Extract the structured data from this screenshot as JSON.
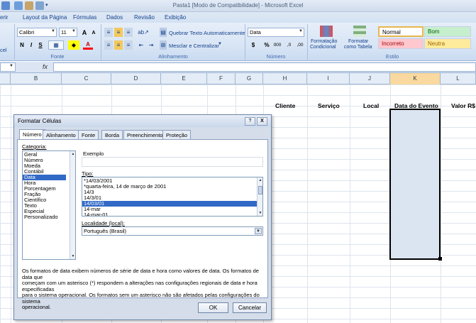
{
  "window": {
    "title": "Pasta1  [Modo de Compatibilidade] - Microsoft Excel"
  },
  "ribbon_tabs": [
    "erir",
    "Layout da Página",
    "Fórmulas",
    "Dados",
    "Revisão",
    "Exibição"
  ],
  "ribbon": {
    "font_name": "Calibri",
    "font_size": "11",
    "bold": "N",
    "italic": "I",
    "underline": "S",
    "grow_font": "A",
    "shrink_font": "A",
    "font_color_glyph": "A",
    "wrap_text": "Quebrar Texto Automaticamente",
    "merge_center": "Mesclar e Centralizar",
    "number_format": "Data",
    "currency": "$",
    "percent": "%",
    "thousands": "000",
    "dec_inc": ",0",
    "dec_dec": ",00",
    "cond_format": [
      "Formatação",
      "Condicional"
    ],
    "format_table": [
      "Formatar",
      "como Tabela"
    ],
    "styles": {
      "normal": "Normal",
      "bom": "Bom",
      "incorreto": "Incorreto",
      "neutra": "Neutra"
    },
    "cell_label": "cel",
    "groups": {
      "fonte": "Fonte",
      "alinhamento": "Alinhamento",
      "numero": "Número",
      "estilo": "Estilo"
    }
  },
  "formula_bar": {
    "fx": "fx",
    "value": ""
  },
  "columns": [
    "B",
    "C",
    "D",
    "E",
    "F",
    "G",
    "H",
    "I",
    "J",
    "K",
    "L"
  ],
  "selected_column": "K",
  "header_cells": {
    "cliente": "Cliente",
    "servico": "Serviço",
    "local": "Local",
    "data_evento": "Data do Evento",
    "valor": "Valor R$"
  },
  "dialog": {
    "title": "Formatar Células",
    "help_btn": "?",
    "close_btn": "X",
    "tabs": [
      "Número",
      "Alinhamento",
      "Fonte",
      "Borda",
      "Preenchimento",
      "Proteção"
    ],
    "active_tab": "Número",
    "category_label": "Categoria:",
    "categories": [
      "Geral",
      "Número",
      "Moeda",
      "Contábil",
      "Data",
      "Hora",
      "Porcentagem",
      "Fração",
      "Científico",
      "Texto",
      "Especial",
      "Personalizado"
    ],
    "selected_category": "Data",
    "sample_label": "Exemplo",
    "type_label": "Tipo:",
    "types": [
      "*14/03/2001",
      "*quarta-feira, 14 de março de 2001",
      "14/3",
      "14/3/01",
      "14/03/01",
      "14-mar",
      "14-mar-01"
    ],
    "selected_type": "14/03/01",
    "locale_label": "Localidade (local):",
    "locale_value": "Português (Brasil)",
    "description": [
      "Os formatos de data exibem números de série de data e hora como valores de data. Os formatos de data que",
      "começam com um asterisco (*) respondem a alterações nas configurações regionais de data e hora especificadas",
      "para o sistema operacional. Os formatos sem um asterisco não são afetados pelas configurações do sistema",
      "operacional."
    ],
    "ok_label": "OK",
    "cancel_label": "Cancelar"
  }
}
